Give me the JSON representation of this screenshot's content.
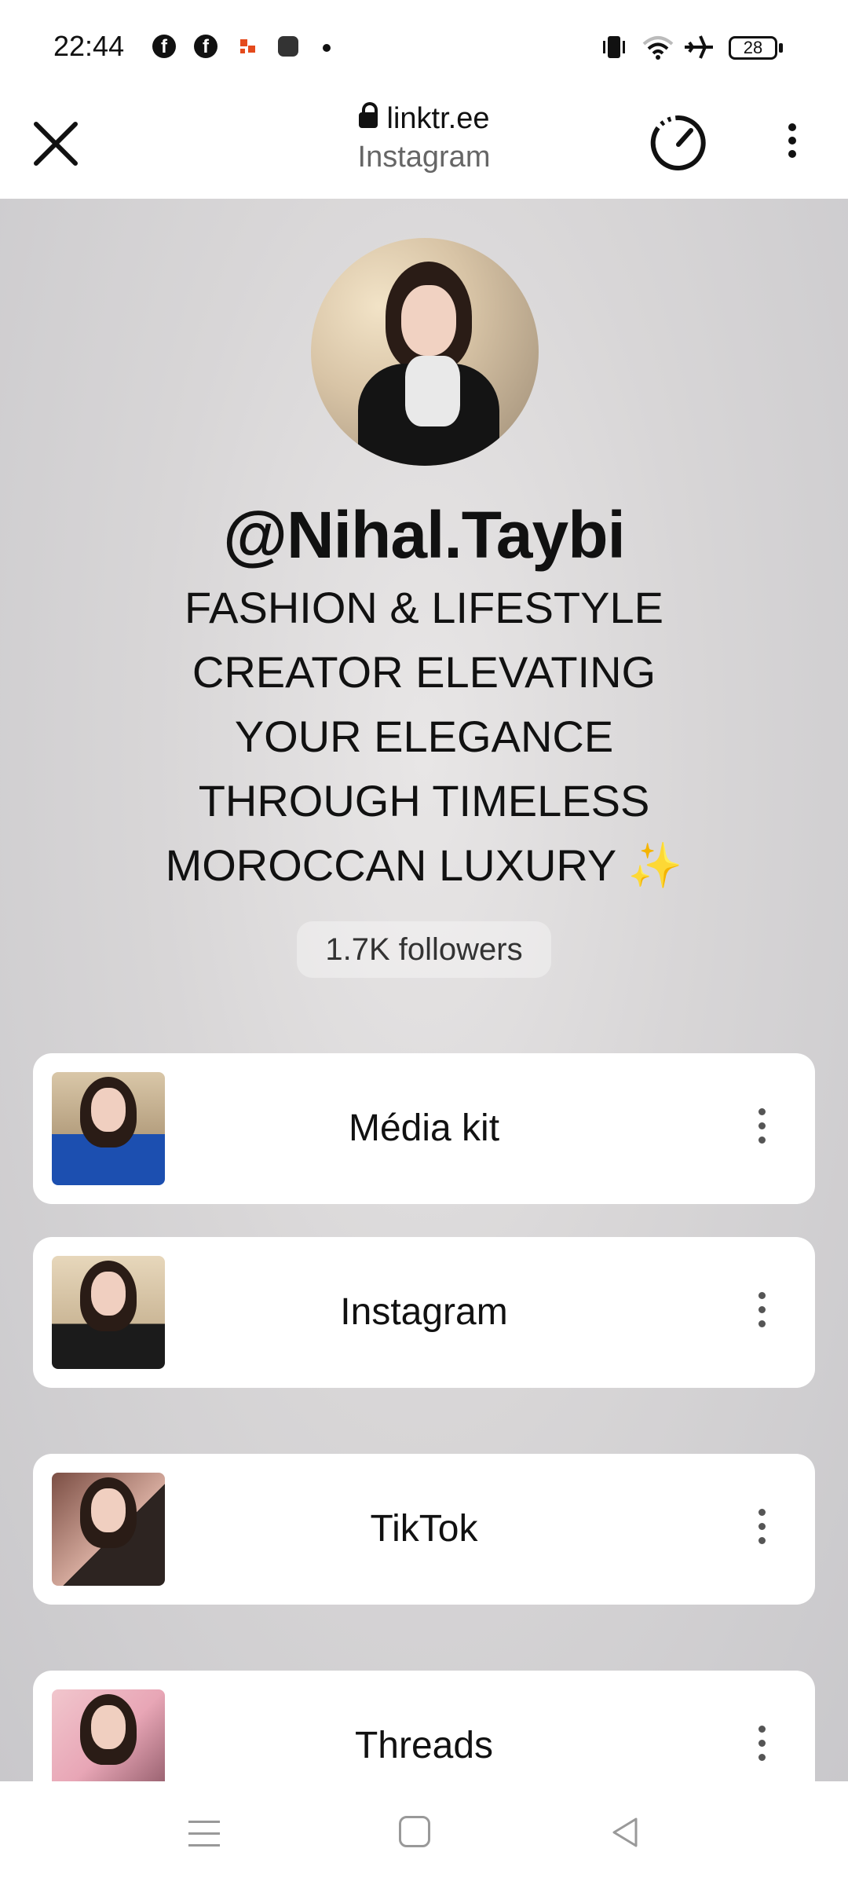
{
  "status_bar": {
    "time": "22:44",
    "battery": "28",
    "icons": [
      "facebook-icon",
      "facebook-icon",
      "app-icon",
      "app-icon",
      "dot-icon",
      "vibrate-icon",
      "wifi-icon",
      "airplane-icon",
      "battery-icon"
    ]
  },
  "browser": {
    "domain": "linktr.ee",
    "page_title": "Instagram",
    "close_icon": "close-icon",
    "timer_icon": "timer-icon",
    "menu_icon": "more-vertical-icon"
  },
  "profile": {
    "handle": "@Nihal.Taybi",
    "bio_lines": [
      "FASHION & LIFESTYLE",
      "CREATOR ELEVATING",
      "YOUR ELEGANCE",
      "THROUGH TIMELESS",
      "MOROCCAN LUXURY ✨"
    ],
    "followers": "1.7K followers"
  },
  "links": [
    {
      "label": "Média kit"
    },
    {
      "label": "Instagram"
    },
    {
      "label": "TikTok"
    },
    {
      "label": "Threads"
    }
  ],
  "colors": {
    "page_background": "#d8d6d7",
    "card_background": "#ffffff",
    "text": "#111111"
  }
}
